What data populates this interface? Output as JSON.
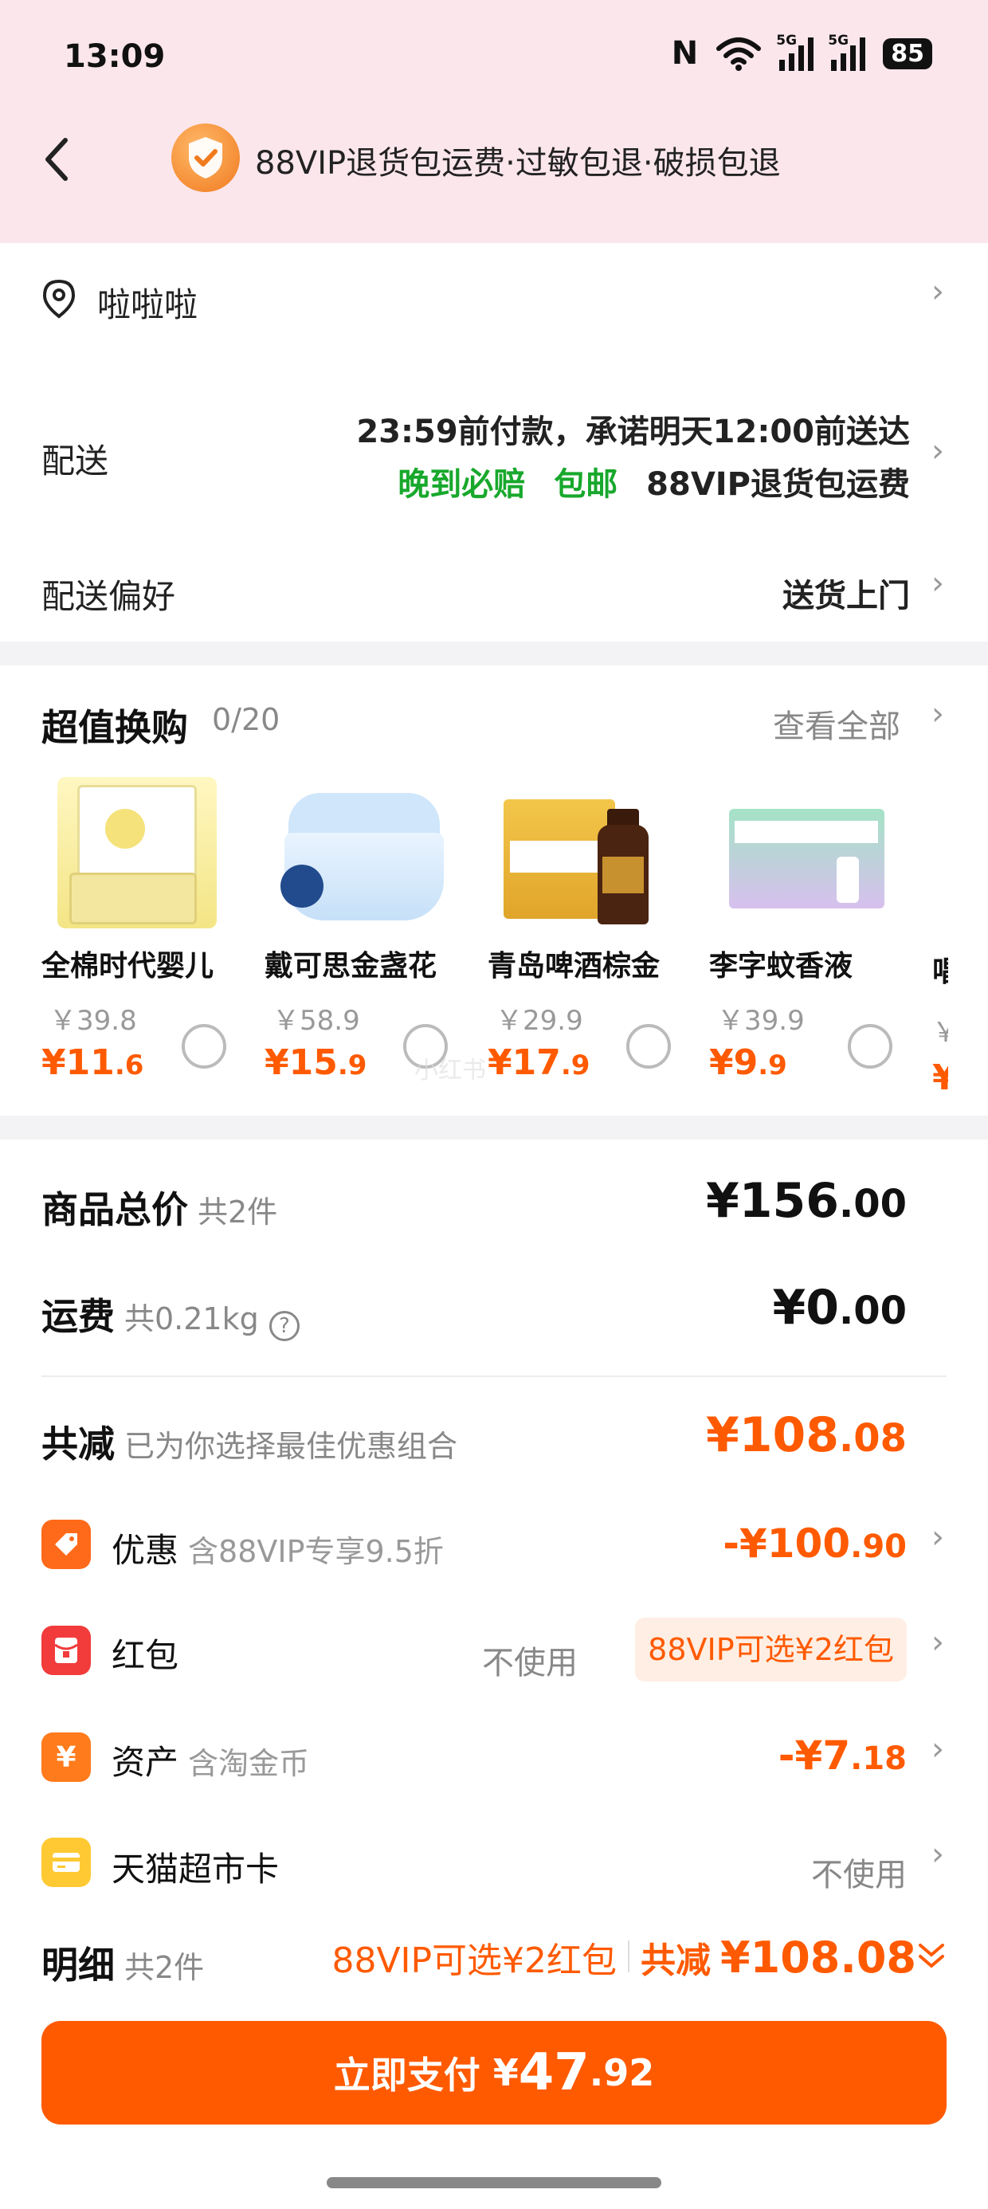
{
  "status_bar": {
    "time": "13:09",
    "nfc": "N",
    "signal_1": "5G",
    "signal_2": "5G",
    "battery": "85"
  },
  "header": {
    "title": "88VIP退货包运费·过敏包退·破损包退"
  },
  "address": {
    "name": "啦啦啦"
  },
  "delivery": {
    "label": "配送",
    "promise": "23:59前付款，承诺明天12:00前送达",
    "tag_late": "晚到必赔",
    "tag_free": "包邮",
    "tag_vip": "88VIP退货包运费"
  },
  "delivery_pref": {
    "label": "配送偏好",
    "value": "送货上门"
  },
  "swap": {
    "title": "超值换购",
    "count": "0/20",
    "view_all": "查看全部",
    "items": [
      {
        "name": "全棉时代婴儿",
        "old_price": "￥39.8",
        "new_price": "¥11",
        "new_dec": ".6"
      },
      {
        "name": "戴可思金盏花",
        "old_price": "￥58.9",
        "new_price": "¥15",
        "new_dec": ".9"
      },
      {
        "name": "青岛啤酒棕金",
        "old_price": "￥29.9",
        "new_price": "¥17",
        "new_dec": ".9"
      },
      {
        "name": "李字蚊香液",
        "old_price": "￥39.9",
        "new_price": "¥9",
        "new_dec": ".9"
      }
    ],
    "partial_name": "唱",
    "partial_old": "￥",
    "partial_new": "¥"
  },
  "summary": {
    "goods_label": "商品总价",
    "goods_count": "共2件",
    "goods_total_int": "¥156",
    "goods_total_dec": ".00",
    "shipping_label": "运费",
    "shipping_weight": "共0.21kg",
    "shipping_int": "¥0",
    "shipping_dec": ".00",
    "reduce_label": "共减",
    "reduce_sub": "已为你选择最佳优惠组合",
    "reduce_int": "¥108",
    "reduce_dec": ".08"
  },
  "discounts": {
    "coupon_label": "优惠",
    "coupon_sub": "含88VIP专享9.5折",
    "coupon_int": "-¥100",
    "coupon_dec": ".90",
    "redpacket_label": "红包",
    "redpacket_none": "不使用",
    "redpacket_tag": "88VIP可选¥2红包",
    "asset_label": "资产",
    "asset_sub": "含淘金币",
    "asset_int": "-¥7",
    "asset_dec": ".18",
    "card_label": "天猫超市卡",
    "card_value": "不使用"
  },
  "detail": {
    "label": "明细",
    "count": "共2件",
    "vip_redpacket": "88VIP可选¥2红包",
    "reduce_label": "共减",
    "reduce_value": "¥108.08"
  },
  "pay": {
    "label": "立即支付",
    "currency": "¥",
    "int": "47",
    "dec": ".92"
  },
  "watermark": "小红书",
  "colors": {
    "accent": "#ff5a00",
    "green": "#18a82c",
    "header_bg": "#fbe6ec"
  }
}
